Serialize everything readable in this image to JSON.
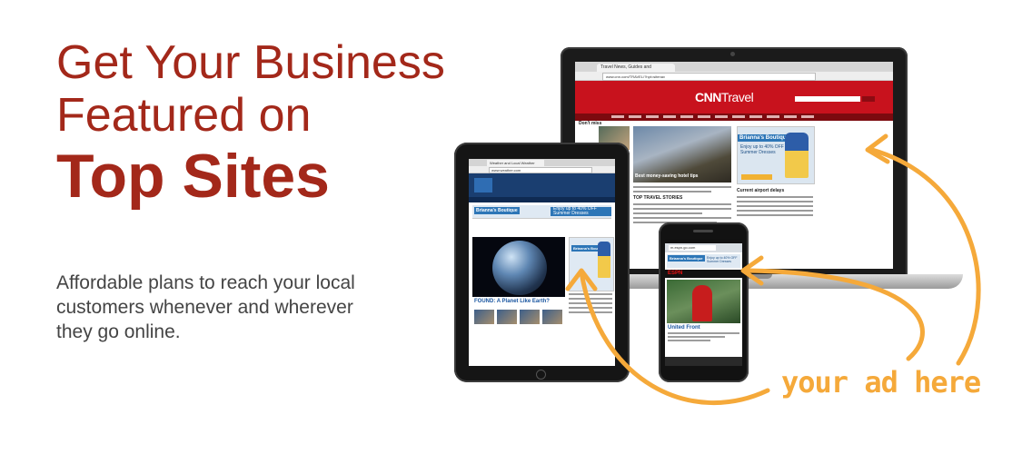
{
  "headline": {
    "line1": "Get Your Business",
    "line2": "Featured on",
    "line3": "Top Sites"
  },
  "subtext": "Affordable plans to reach your local customers whenever and wherever they go online.",
  "callout": "your ad here",
  "laptop": {
    "tab_title": "Travel News, Guides and",
    "url": "www.cnn.com/TRAVEL/?hpt=sitenav",
    "logo_brand": "CNN",
    "logo_section": "Travel",
    "section_label": "Don't miss",
    "photo_caption": "Best money-saving hotel tips",
    "stories_heading": "TOP TRAVEL STORIES",
    "ad": {
      "brand": "Brianna's Boutique",
      "text": "Enjoy up to 40% OFF on Flirty Summer Dresses"
    },
    "airport_title": "Current airport delays"
  },
  "tablet": {
    "tab_title": "Weather and Local Weather",
    "url": "www.weather.com",
    "ad_brand": "Brianna's Boutique",
    "ad_banner": "Enjoy up to 40% OFF Summer Dresses",
    "headline": "FOUND: A Planet Like Earth?"
  },
  "phone": {
    "url": "m.espn.go.com",
    "ad_brand": "Brianna's Boutique",
    "ad_text": "Enjoy up to 40% OFF Summer Dresses",
    "brand": "ESPN",
    "story_title": "United Front"
  },
  "colors": {
    "headline": "#a3281a",
    "accent_orange": "#f5a93a",
    "cnn_red": "#c8121d"
  }
}
